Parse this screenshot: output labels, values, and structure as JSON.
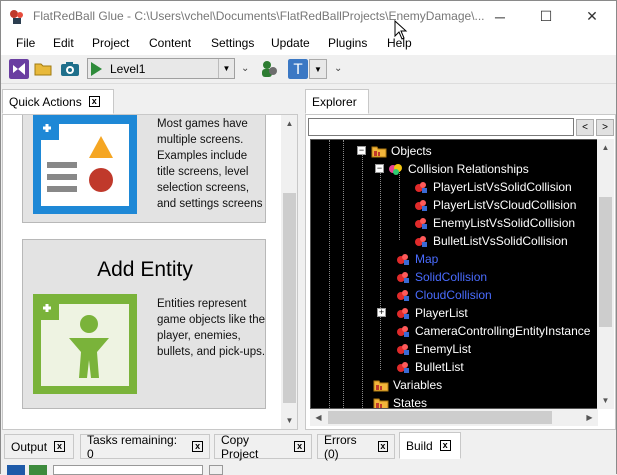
{
  "window": {
    "title": "FlatRedBall Glue - C:\\Users\\vchel\\Documents\\FlatRedBallProjects\\EnemyDamage\\...",
    "minimize": "─",
    "maximize": "☐",
    "close": "✕"
  },
  "menu": {
    "items": [
      "File",
      "Edit",
      "Project",
      "Content",
      "Settings",
      "Update",
      "Plugins",
      "Help"
    ]
  },
  "toolbar": {
    "level_combo_value": "Level1",
    "overflow_glyph": "⌄"
  },
  "quick_actions": {
    "tab_label": "Quick Actions",
    "close_glyph": "x",
    "screen_card": {
      "description": "Most games have multiple screens. Examples include title screens, level selection screens, and settings screens"
    },
    "entity_card": {
      "title": "Add Entity",
      "description": "Entities represent game objects like the player, enemies, bullets, and pick-ups."
    }
  },
  "explorer": {
    "tab_label": "Explorer",
    "search_value": "",
    "back_glyph": "<",
    "forward_glyph": ">",
    "tree": [
      {
        "label": "Objects",
        "kind": "folder",
        "color": "white",
        "expander": "−"
      },
      {
        "label": "Collision Relationships",
        "kind": "collision",
        "color": "white",
        "expander": "−"
      },
      {
        "label": "PlayerListVsSolidCollision",
        "kind": "object",
        "color": "white"
      },
      {
        "label": "PlayerListVsCloudCollision",
        "kind": "object",
        "color": "white"
      },
      {
        "label": "EnemyListVsSolidCollision",
        "kind": "object",
        "color": "white"
      },
      {
        "label": "BulletListVsSolidCollision",
        "kind": "object",
        "color": "white"
      },
      {
        "label": "Map",
        "kind": "object",
        "color": "blue"
      },
      {
        "label": "SolidCollision",
        "kind": "object",
        "color": "blue"
      },
      {
        "label": "CloudCollision",
        "kind": "object",
        "color": "blue"
      },
      {
        "label": "PlayerList",
        "kind": "object",
        "color": "white",
        "expander": "+"
      },
      {
        "label": "CameraControllingEntityInstance",
        "kind": "object",
        "color": "white"
      },
      {
        "label": "EnemyList",
        "kind": "object",
        "color": "white"
      },
      {
        "label": "BulletList",
        "kind": "object",
        "color": "white"
      },
      {
        "label": "Variables",
        "kind": "folder",
        "color": "white"
      },
      {
        "label": "States",
        "kind": "folder",
        "color": "white"
      }
    ]
  },
  "bottom_tabs": [
    {
      "label": "Output"
    },
    {
      "label": "Tasks remaining: 0"
    },
    {
      "label": "Copy Project"
    },
    {
      "label": "Errors (0)"
    },
    {
      "label": "Build"
    }
  ],
  "colors": {
    "accent_blue": "#1e88d6",
    "entity_green": "#7ab33a",
    "tree_bg": "#000000",
    "blue_label": "#4a6cff"
  }
}
